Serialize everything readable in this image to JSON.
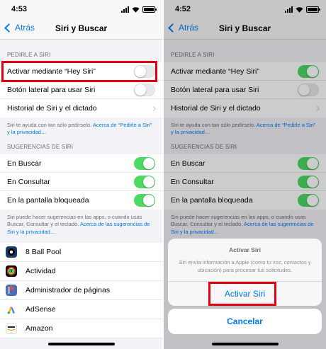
{
  "left": {
    "time": "4:53",
    "nav": {
      "back": "Atrás",
      "title": "Siri y Buscar"
    },
    "section1_header": "PEDIRLE A SIRI",
    "rows1": [
      {
        "label": "Activar mediante “Hey Siri”",
        "toggle": "off"
      },
      {
        "label": "Botón lateral para usar Siri",
        "toggle": "off"
      },
      {
        "label": "Historial de Siri y el dictado",
        "toggle": "chevron"
      }
    ],
    "footer1_text": "Siri te ayuda con tan sólo pedírselo. ",
    "footer1_link": "Acerca de “Pedirle a Siri” y la privacidad…",
    "section2_header": "SUGERENCIAS DE SIRI",
    "rows2": [
      {
        "label": "En Buscar",
        "toggle": "on"
      },
      {
        "label": "En Consultar",
        "toggle": "on"
      },
      {
        "label": "En la pantalla bloqueada",
        "toggle": "on"
      }
    ],
    "footer2_text": "Siri puede hacer sugerencias en las apps, o cuando usas Buscar, Consultar y el teclado. ",
    "footer2_link": "Acerca de las sugerencias de Siri y la privacidad…",
    "apps": [
      {
        "label": "8 Ball Pool",
        "icon": "8-ball-pool-icon",
        "color": "#1b3a6b"
      },
      {
        "label": "Actividad",
        "icon": "activity-rings-icon",
        "color": "#000000"
      },
      {
        "label": "Administrador de páginas",
        "icon": "flag-icon",
        "color": "#4a6fb5"
      },
      {
        "label": "AdSense",
        "icon": "adsense-icon",
        "color": "#ffffff"
      },
      {
        "label": "Amazon",
        "icon": "amazon-icon",
        "color": "#ffffff"
      }
    ]
  },
  "right": {
    "time": "4:52",
    "nav": {
      "back": "Atrás",
      "title": "Siri y Buscar"
    },
    "section1_header": "PEDIRLE A SIRI",
    "rows1": [
      {
        "label": "Activar mediante “Hey Siri”",
        "toggle": "on"
      },
      {
        "label": "Botón lateral para usar Siri",
        "toggle": "off"
      },
      {
        "label": "Historial de Siri y el dictado",
        "toggle": "chevron"
      }
    ],
    "footer1_text": "Siri te ayuda con tan sólo pedírselo. ",
    "footer1_link": "Acerca de “Pedirle a Siri” y la privacidad…",
    "section2_header": "SUGERENCIAS DE SIRI",
    "rows2": [
      {
        "label": "En Buscar",
        "toggle": "on"
      },
      {
        "label": "En Consultar",
        "toggle": "on"
      },
      {
        "label": "En la pantalla bloqueada",
        "toggle": "on"
      }
    ],
    "footer2_text": "Siri puede hacer sugerencias en las apps, o cuando usas Buscar, Consultar y el teclado. ",
    "footer2_link": "Acerca de las sugerencias de Siri y la privacidad…",
    "sheet": {
      "title": "Activar Siri",
      "message": "Siri envía información a Apple (como tu voz, contactos y ubicación) para procesar tus solicitudes.",
      "action": "Activar Siri",
      "cancel": "Cancelar"
    }
  },
  "colors": {
    "accent": "#007aff",
    "toggle_on": "#4cd964",
    "highlight": "#e00012"
  }
}
